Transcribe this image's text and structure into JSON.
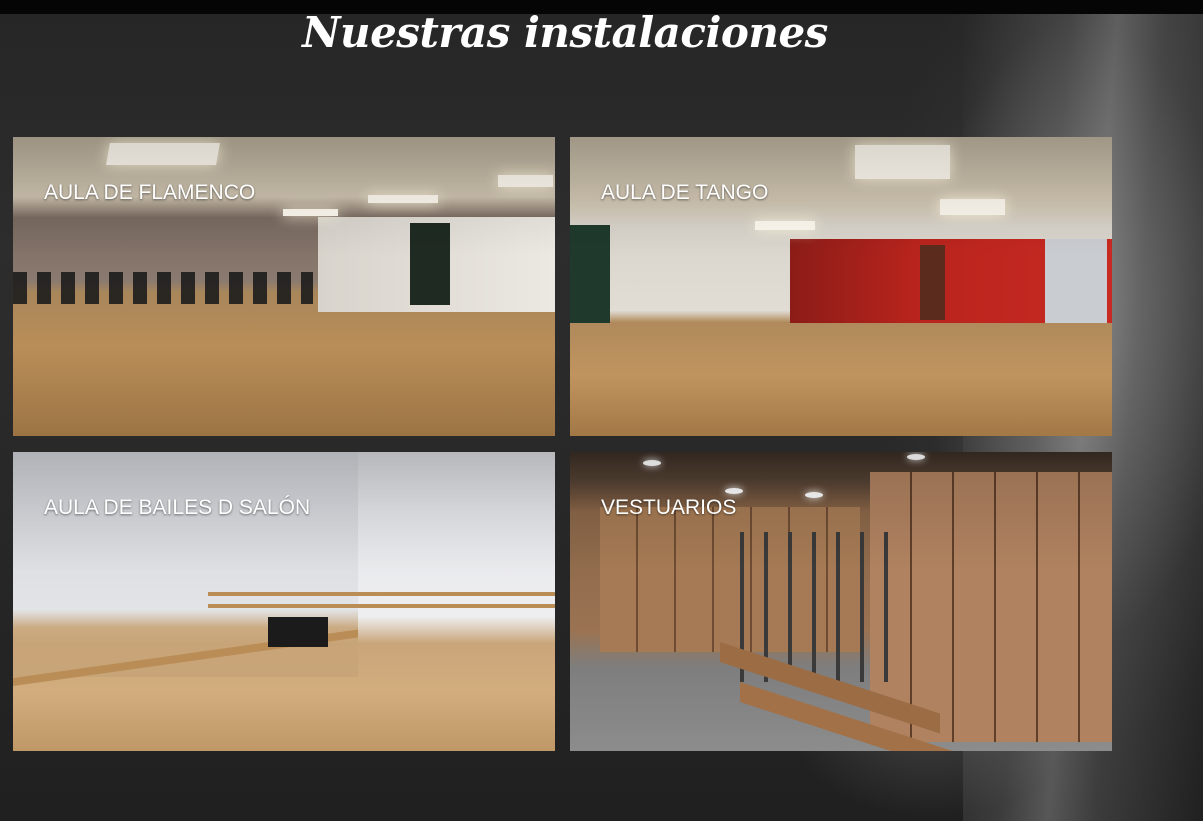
{
  "page": {
    "title": "Nuestras instalaciones"
  },
  "rooms": [
    {
      "label": "AULA DE FLAMENCO",
      "image": "dance-studio-photo"
    },
    {
      "label": "AULA DE TANGO",
      "image": "dance-studio-photo"
    },
    {
      "label": "AULA DE BAILES D SALÓN",
      "image": "dance-studio-photo"
    },
    {
      "label": "VESTUARIOS",
      "image": "locker-room-photo"
    }
  ],
  "colors": {
    "background": "#262626",
    "title_text": "#ffffff",
    "label_text": "#ffffff"
  }
}
